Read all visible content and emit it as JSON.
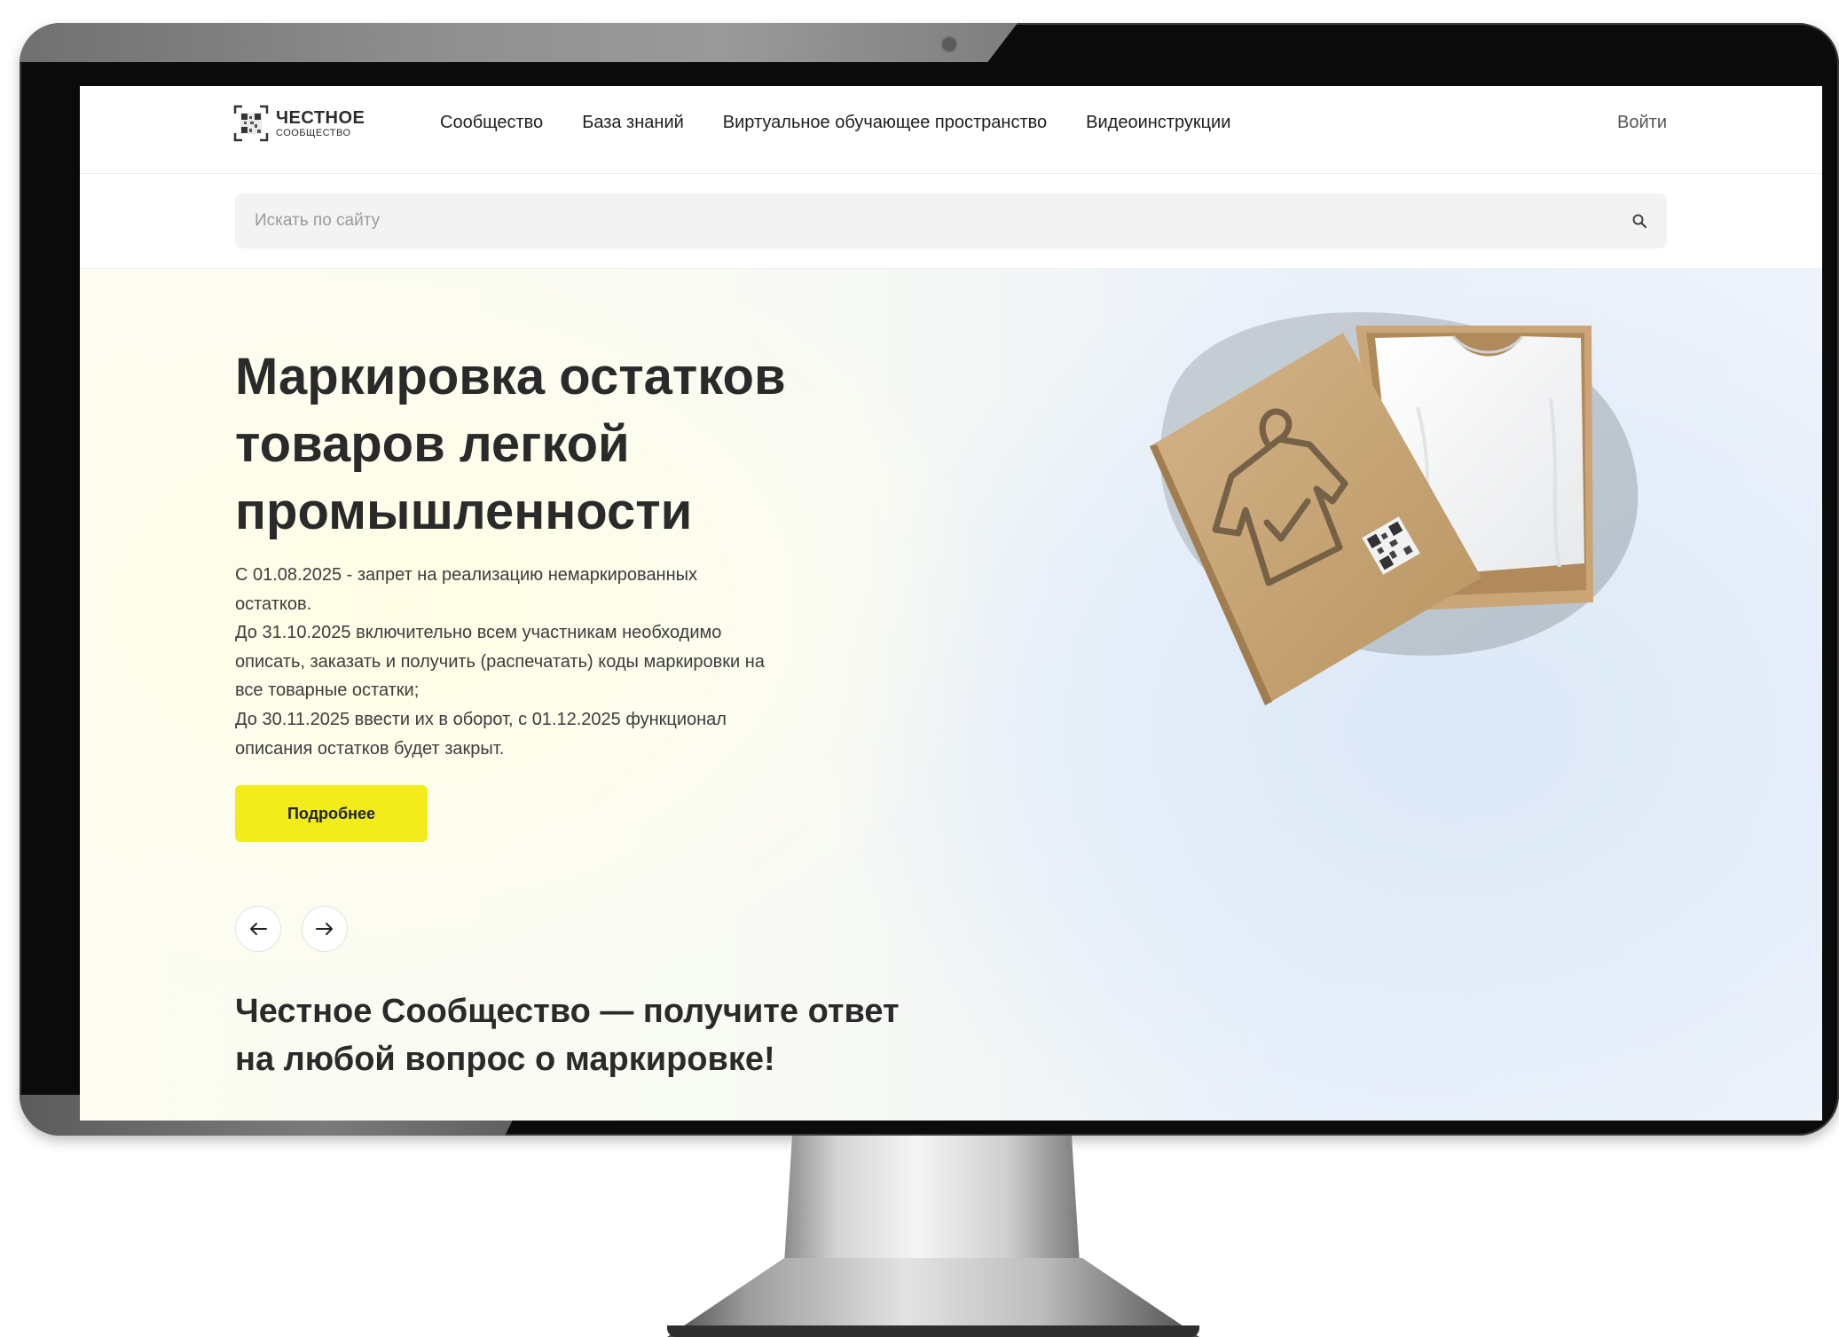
{
  "header": {
    "logo": {
      "line1": "ЧЕСТНОЕ",
      "line2": "СООБЩЕСТВО"
    },
    "nav": [
      {
        "label": "Сообщество"
      },
      {
        "label": "База знаний"
      },
      {
        "label": "Виртуальное обучающее пространство"
      },
      {
        "label": "Видеоинструкции"
      }
    ],
    "login_label": "Войти"
  },
  "search": {
    "placeholder": "Искать по сайту",
    "icon": "search-icon"
  },
  "hero": {
    "title_lines": [
      "Маркировка остатков",
      "товаров легкой",
      "промышленности"
    ],
    "description_lines": [
      "С 01.08.2025 - запрет на реализацию немаркированных",
      "остатков.",
      "До 31.10.2025 включительно всем участникам необходимо",
      "описать, заказать и получить (распечатать) коды маркировки на",
      "все товарные остатки;",
      "До 30.11.2025 ввести их в оборот, с 01.12.2025 функционал",
      "описания остатков будет закрыт."
    ],
    "button_label": "Подробнее",
    "prev_icon": "arrow-left-icon",
    "next_icon": "arrow-right-icon",
    "subtitle_lines": [
      "Честное Сообщество — получите ответ",
      "на любой вопрос о маркировке!"
    ],
    "accent_color": "#f2ec1b"
  }
}
